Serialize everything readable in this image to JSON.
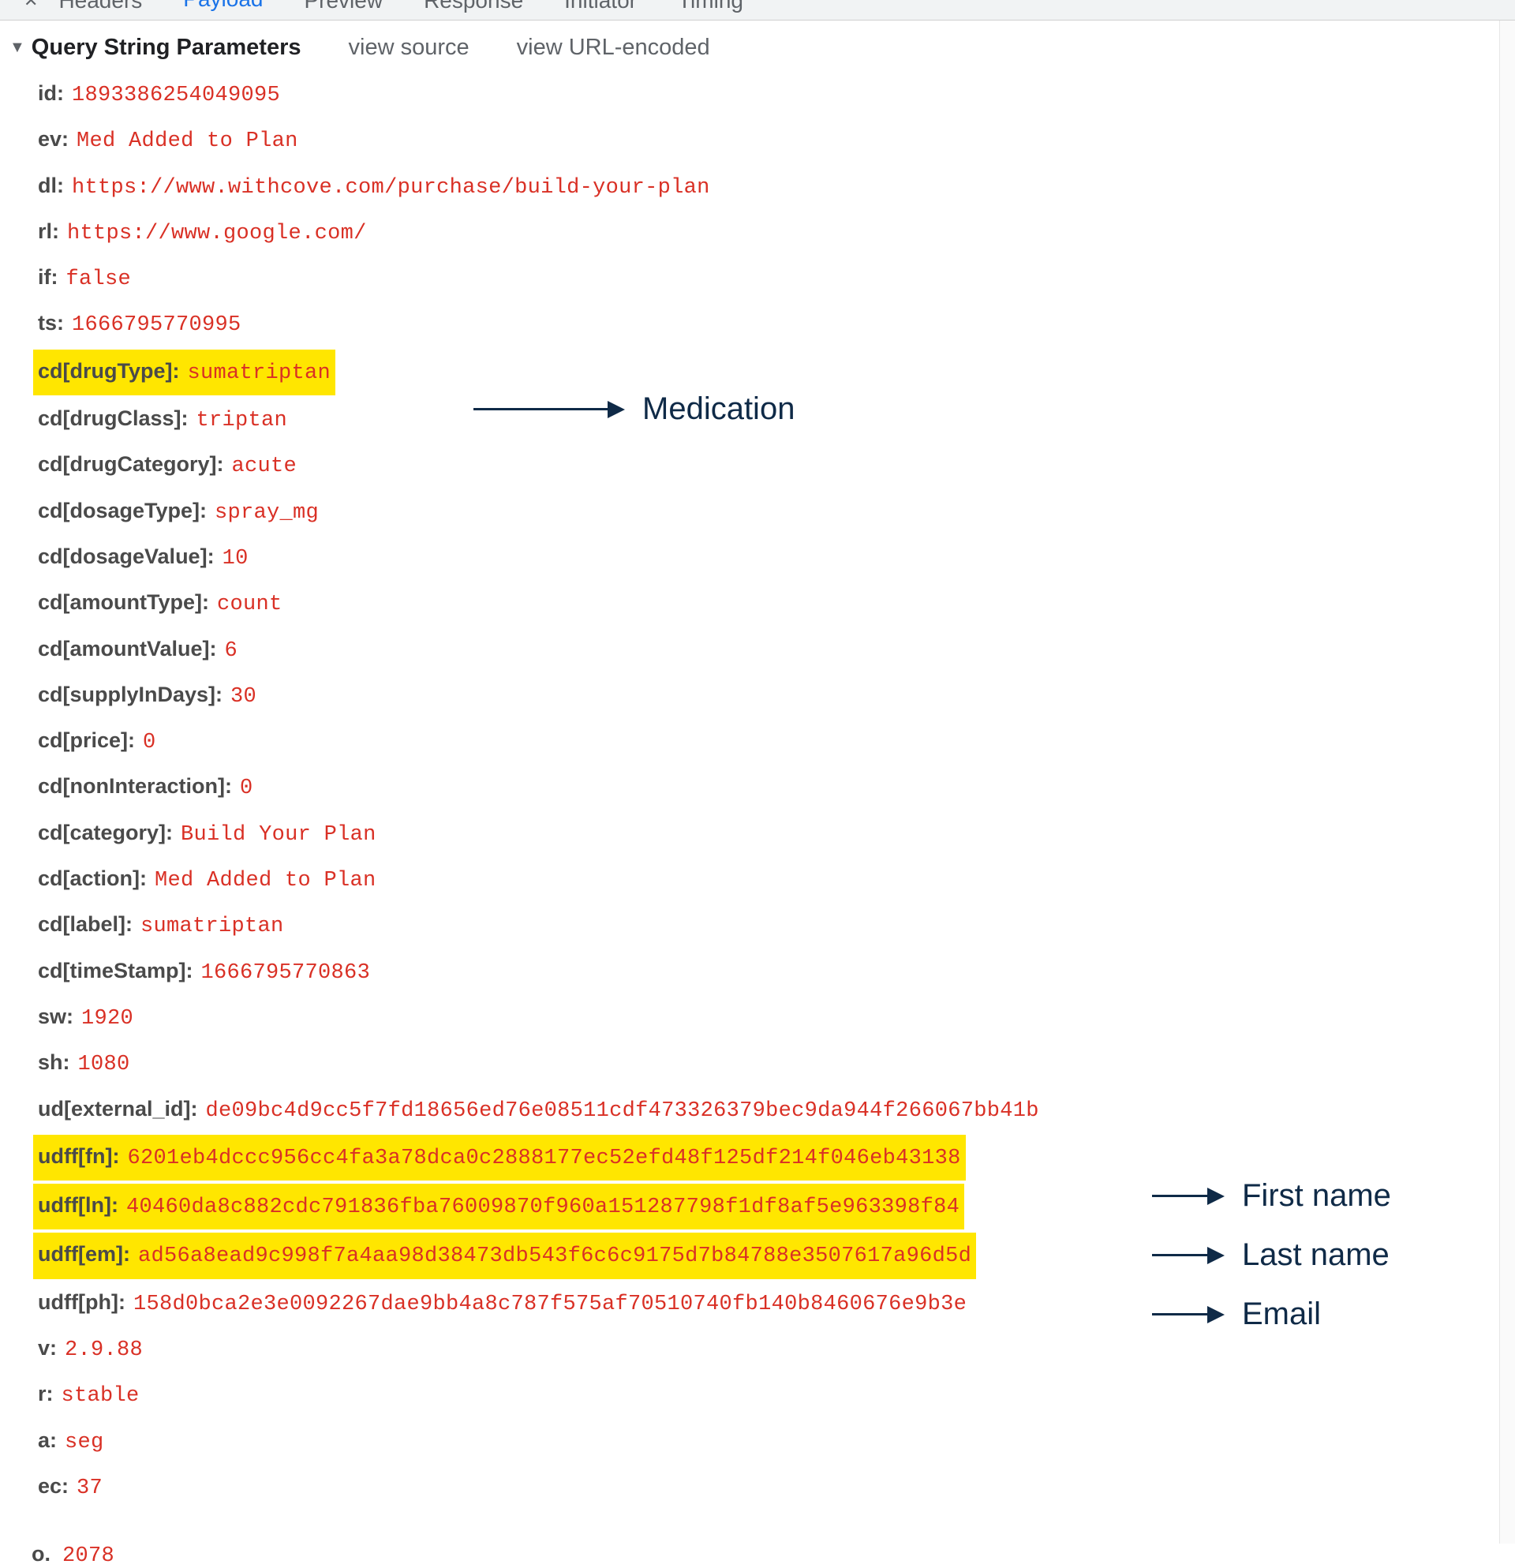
{
  "tabs": {
    "headers": "Headers",
    "payload": "Payload",
    "preview": "Preview",
    "response": "Response",
    "initiator": "Initiator",
    "timing": "Timing"
  },
  "section": {
    "title": "Query String Parameters",
    "view_source": "view source",
    "view_url_encoded": "view URL-encoded"
  },
  "params": {
    "id": {
      "k": "id",
      "v": "1893386254049095"
    },
    "ev": {
      "k": "ev",
      "v": "Med Added to Plan"
    },
    "dl": {
      "k": "dl",
      "v": "https://www.withcove.com/purchase/build-your-plan"
    },
    "rl": {
      "k": "rl",
      "v": "https://www.google.com/"
    },
    "if": {
      "k": "if",
      "v": "false"
    },
    "ts": {
      "k": "ts",
      "v": "1666795770995"
    },
    "cd_drugType": {
      "k": "cd[drugType]",
      "v": "sumatriptan"
    },
    "cd_drugClass": {
      "k": "cd[drugClass]",
      "v": "triptan"
    },
    "cd_drugCategory": {
      "k": "cd[drugCategory]",
      "v": "acute"
    },
    "cd_dosageType": {
      "k": "cd[dosageType]",
      "v": "spray_mg"
    },
    "cd_dosageValue": {
      "k": "cd[dosageValue]",
      "v": "10"
    },
    "cd_amountType": {
      "k": "cd[amountType]",
      "v": "count"
    },
    "cd_amountValue": {
      "k": "cd[amountValue]",
      "v": "6"
    },
    "cd_supplyInDays": {
      "k": "cd[supplyInDays]",
      "v": "30"
    },
    "cd_price": {
      "k": "cd[price]",
      "v": "0"
    },
    "cd_nonInteraction": {
      "k": "cd[nonInteraction]",
      "v": "0"
    },
    "cd_category": {
      "k": "cd[category]",
      "v": "Build Your Plan"
    },
    "cd_action": {
      "k": "cd[action]",
      "v": "Med Added to Plan"
    },
    "cd_label": {
      "k": "cd[label]",
      "v": "sumatriptan"
    },
    "cd_timeStamp": {
      "k": "cd[timeStamp]",
      "v": "1666795770863"
    },
    "sw": {
      "k": "sw",
      "v": "1920"
    },
    "sh": {
      "k": "sh",
      "v": "1080"
    },
    "ud_external_id": {
      "k": "ud[external_id]",
      "v": "de09bc4d9cc5f7fd18656ed76e08511cdf473326379bec9da944f266067bb41b"
    },
    "udff_fn": {
      "k": "udff[fn]",
      "v": "6201eb4dccc956cc4fa3a78dca0c2888177ec52efd48f125df214f046eb43138"
    },
    "udff_ln": {
      "k": "udff[ln]",
      "v": "40460da8c882cdc791836fba76009870f960a151287798f1df8af5e963398f84"
    },
    "udff_em": {
      "k": "udff[em]",
      "v": "ad56a8ead9c998f7a4aa98d38473db543f6c6c9175d7b84788e3507617a96d5d"
    },
    "udff_ph": {
      "k": "udff[ph]",
      "v": "158d0bca2e3e0092267dae9bb4a8c787f575af70510740fb140b8460676e9b3e"
    },
    "vv": {
      "k": "v",
      "v": "2.9.88"
    },
    "r": {
      "k": "r",
      "v": "stable"
    },
    "a": {
      "k": "a",
      "v": "seg"
    },
    "ec": {
      "k": "ec",
      "v": "37"
    },
    "cut": {
      "k": "o.",
      "v": "2078"
    }
  },
  "annotations": {
    "medication": "Medication",
    "first_name": "First name",
    "last_name": "Last name",
    "email": "Email"
  }
}
